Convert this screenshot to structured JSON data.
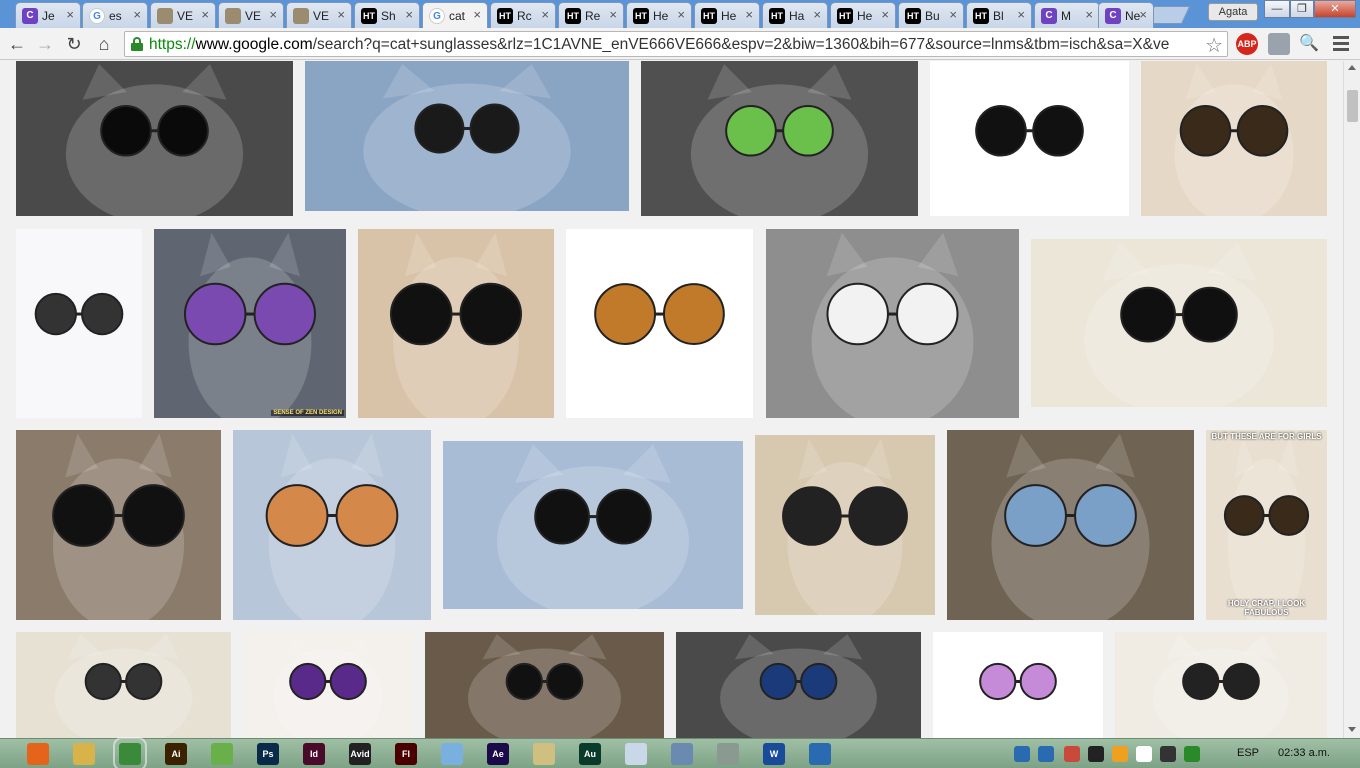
{
  "browser": {
    "tabs": [
      {
        "label": "Je",
        "icon": "c-icon",
        "active": false
      },
      {
        "label": "es",
        "icon": "google-icon",
        "active": false
      },
      {
        "label": "VE",
        "icon": "photo-icon",
        "active": false
      },
      {
        "label": "VE",
        "icon": "photo-icon",
        "active": false
      },
      {
        "label": "VE",
        "icon": "photo-icon",
        "active": false
      },
      {
        "label": "Sh",
        "icon": "ht-icon",
        "active": false
      },
      {
        "label": "cat",
        "icon": "google-icon",
        "active": true
      },
      {
        "label": "Rc",
        "icon": "ht-icon",
        "active": false
      },
      {
        "label": "Re",
        "icon": "ht-icon",
        "active": false
      },
      {
        "label": "He",
        "icon": "ht-icon",
        "active": false
      },
      {
        "label": "He",
        "icon": "ht-icon",
        "active": false
      },
      {
        "label": "Ha",
        "icon": "ht-icon",
        "active": false
      },
      {
        "label": "He",
        "icon": "ht-icon",
        "active": false
      },
      {
        "label": "Bu",
        "icon": "ht-icon",
        "active": false
      },
      {
        "label": "Bl",
        "icon": "ht-icon",
        "active": false
      },
      {
        "label": "M",
        "icon": "c-icon",
        "active": false
      },
      {
        "label": "Ne",
        "icon": "c-icon",
        "active": false
      }
    ],
    "tab_close_glyph": "×",
    "profile_name": "Agata",
    "window_buttons": {
      "minimize": "—",
      "maximize": "❐",
      "close": "✕"
    },
    "nav": {
      "back": "←",
      "forward": "→",
      "reload": "↻",
      "home": "⌂"
    },
    "address": {
      "scheme": "https://",
      "host": "www.google.com",
      "path": "/search?q=cat+sunglasses&rlz=1C1AVNE_enVE666VE666&espv=2&biw=1360&bih=677&source=lnms&tbm=isch&sa=X&ve"
    },
    "star_glyph": "☆",
    "extensions": [
      {
        "label": "ABP"
      },
      {
        "label": ""
      },
      {
        "label": "🔍"
      }
    ]
  },
  "images": [
    {
      "name": "cat-round-black-glasses",
      "bg": "#4a4a4a",
      "accent": "#0a0a0a"
    },
    {
      "name": "three-cats-sunglasses",
      "bg": "#8aa4c4",
      "accent": "#1a1a1a"
    },
    {
      "name": "cat-galaxy-glasses",
      "bg": "#505050",
      "accent": "#6ac04a"
    },
    {
      "name": "black-round-sunglasses",
      "bg": "#ffffff",
      "accent": "#111111"
    },
    {
      "name": "white-cat-glasses",
      "bg": "#e6d8c6",
      "accent": "#3a2a1a"
    },
    {
      "name": "cat-eye-sunglasses",
      "bg": "#f8f8fa",
      "accent": "#333333"
    },
    {
      "name": "cat-space-glasses",
      "bg": "#5f6672",
      "accent": "#7a4ab0"
    },
    {
      "name": "orange-white-cat-shades",
      "bg": "#d9c3a8",
      "accent": "#111111"
    },
    {
      "name": "cat-shaped-glasses",
      "bg": "#ffffff",
      "accent": "#c07a2a"
    },
    {
      "name": "cat-hammock-aviators",
      "bg": "#8e8e8e",
      "accent": "#f2f2f2"
    },
    {
      "name": "cat-dark-round-glasses",
      "bg": "#ece6d9",
      "accent": "#101010"
    },
    {
      "name": "cat-in-pot-shades",
      "bg": "#8a7b6a",
      "accent": "#111111"
    },
    {
      "name": "cat-fish-glasses",
      "bg": "#b7c6d8",
      "accent": "#d4884a"
    },
    {
      "name": "cats-fence-sunglasses",
      "bg": "#a8bcd6",
      "accent": "#111111"
    },
    {
      "name": "woman-and-sunglasses-collage",
      "bg": "#d7c8b0",
      "accent": "#222222"
    },
    {
      "name": "cat-jeweled-goggles",
      "bg": "#6f6353",
      "accent": "#7aa0c8"
    },
    {
      "name": "cat-glamour-meme",
      "bg": "#e9dfd0",
      "accent": "#3a2a1a"
    },
    {
      "name": "cat-round-glasses-bottom",
      "bg": "#e7e1d4",
      "accent": "#333333"
    },
    {
      "name": "cat-galaxy-glasses-2",
      "bg": "#f4f0ec",
      "accent": "#5a2a8a"
    },
    {
      "name": "three-cats-shades-2",
      "bg": "#6a5a4a",
      "accent": "#111111"
    },
    {
      "name": "cat-hat-glasses",
      "bg": "#4a4a4a",
      "accent": "#1a3a7a"
    },
    {
      "name": "pink-cat-eye-glasses",
      "bg": "#ffffff",
      "accent": "#c58ad8"
    },
    {
      "name": "rihanna-and-glasses",
      "bg": "#f0ece4",
      "accent": "#222222"
    }
  ],
  "meme_text": {
    "top": "BUT THESE ARE FOR GIRLS",
    "bottom": "HOLY CRAP, I LOOK FABULOUS"
  },
  "image_watermark": "SENSE OF ZEN DESIGN",
  "taskbar": {
    "apps": [
      {
        "name": "firefox-icon",
        "label": "",
        "color": "#e5641c"
      },
      {
        "name": "file-explorer-icon",
        "label": "",
        "color": "#d8b34a"
      },
      {
        "name": "chrome-icon",
        "label": "",
        "color": "#3a8a3a"
      },
      {
        "name": "illustrator-icon",
        "label": "Ai",
        "color": "#3a2200"
      },
      {
        "name": "utorrent-icon",
        "label": "",
        "color": "#6ab04a"
      },
      {
        "name": "photoshop-icon",
        "label": "Ps",
        "color": "#0a2a4a"
      },
      {
        "name": "indesign-icon",
        "label": "Id",
        "color": "#4a0a2a"
      },
      {
        "name": "avid-icon",
        "label": "Avid",
        "color": "#222222"
      },
      {
        "name": "flash-icon",
        "label": "Fl",
        "color": "#4a0000"
      },
      {
        "name": "notepad-icon",
        "label": "",
        "color": "#7ab0e0"
      },
      {
        "name": "after-effects-icon",
        "label": "Ae",
        "color": "#1a0a4a"
      },
      {
        "name": "folder-icon",
        "label": "",
        "color": "#d0c080"
      },
      {
        "name": "audition-icon",
        "label": "Au",
        "color": "#0a3a2a"
      },
      {
        "name": "paint-icon",
        "label": "",
        "color": "#c8d8e8"
      },
      {
        "name": "calculator-icon",
        "label": "",
        "color": "#6a8ab0"
      },
      {
        "name": "pen-icon",
        "label": "",
        "color": "#8a9a90"
      },
      {
        "name": "word-icon",
        "label": "W",
        "color": "#1a4a9a"
      },
      {
        "name": "network-icon",
        "label": "",
        "color": "#2a6ab0"
      }
    ],
    "tray": [
      "#2a6ab0",
      "#2a6ab0",
      "#c84a3a",
      "#222222",
      "#f0a020",
      "#ffffff",
      "#333333",
      "#2a8a2a"
    ],
    "language": "ESP",
    "clock": "02:33 a.m."
  }
}
